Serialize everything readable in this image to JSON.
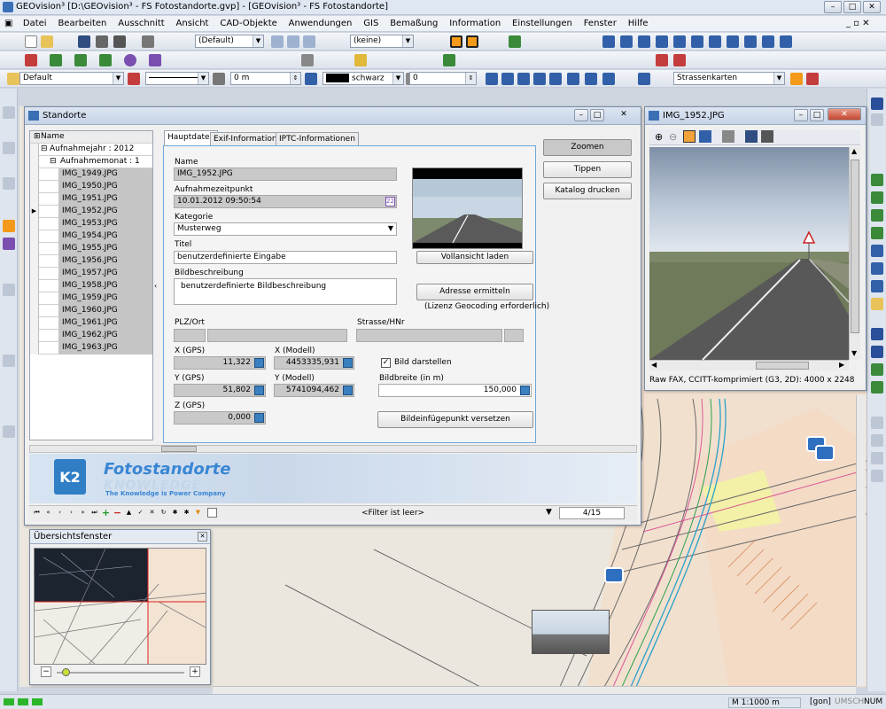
{
  "app": {
    "title": "GEOvision³  [D:\\GEOvision³ - FS Fotostandorte.gvp] - [GEOvision³ - FS Fotostandorte]"
  },
  "menu": [
    "Datei",
    "Bearbeiten",
    "Ausschnitt",
    "Ansicht",
    "CAD-Objekte",
    "Anwendungen",
    "GIS",
    "Bemaßung",
    "Information",
    "Einstellungen",
    "Fenster",
    "Hilfe"
  ],
  "toolbar": {
    "style_combo": "(Default)",
    "layer_combo": "(keine)",
    "profile_combo": "Default",
    "offset": "0 m",
    "color_label": "schwarz",
    "value": "0",
    "map_combo": "Strassenkarten"
  },
  "standorte": {
    "title": "Standorte",
    "tree_header": "Name",
    "year_node": "Aufnahmejahr : 2012",
    "month_node": "Aufnahmemonat : 1",
    "files": [
      "IMG_1949.JPG",
      "IMG_1950.JPG",
      "IMG_1951.JPG",
      "IMG_1952.JPG",
      "IMG_1953.JPG",
      "IMG_1954.JPG",
      "IMG_1955.JPG",
      "IMG_1956.JPG",
      "IMG_1957.JPG",
      "IMG_1958.JPG",
      "IMG_1959.JPG",
      "IMG_1960.JPG",
      "IMG_1961.JPG",
      "IMG_1962.JPG",
      "IMG_1963.JPG"
    ],
    "tabs": [
      "Hauptdaten",
      "Exif-Informationen",
      "IPTC-Informationen"
    ],
    "labels": {
      "name": "Name",
      "zeit": "Aufnahmezeitpunkt",
      "kategorie": "Kategorie",
      "titel": "Titel",
      "beschreibung": "Bildbeschreibung",
      "plz": "PLZ/Ort",
      "strasse": "Strasse/HNr",
      "xgps": "X (GPS)",
      "xmod": "X (Modell)",
      "ygps": "Y (GPS)",
      "ymod": "Y (Modell)",
      "zgps": "Z (GPS)",
      "bildbreite": "Bildbreite (in m)",
      "bild_darstellen": "Bild darstellen"
    },
    "values": {
      "name": "IMG_1952.JPG",
      "zeit": "10.01.2012 09:50:54",
      "kategorie": "Musterweg",
      "titel": "benutzerdefinierte Eingabe",
      "beschreibung": "benutzerdefinierte Bildbeschreibung",
      "xgps": "11,322",
      "xmod": "4453335,931",
      "ygps": "51,802",
      "ymod": "5741094,462",
      "zgps": "0,000",
      "bildbreite": "150,000"
    },
    "buttons": {
      "vollansicht": "Vollansicht laden",
      "adresse": "Adresse ermitteln",
      "lizenz": "(Lizenz Geocoding erforderlich)",
      "versetzen": "Bildeinfügepunkt versetzen",
      "zoomen": "Zoomen",
      "tippen": "Tippen",
      "katalog": "Katalog drucken"
    },
    "banner": {
      "title": "Fotostandorte",
      "brand": "KNOWLEDGE",
      "slogan": "The Knowledge is Power Company",
      "logo": "K2"
    },
    "filter": "<Filter ist leer>",
    "record": "4/15"
  },
  "image_window": {
    "title": "IMG_1952.JPG",
    "status": "Raw FAX, CCITT-komprimiert (G3, 2D): 4000 x 2248"
  },
  "overview": {
    "title": "Übersichtsfenster"
  },
  "status": {
    "scale": "M 1:1000  m",
    "unit": "[gon]",
    "caps": "UMSCH",
    "num": "NUM"
  },
  "colors": {
    "accent": "#3c7fc4",
    "selected": "#c5c5c5",
    "road": "#5a5a5a"
  }
}
